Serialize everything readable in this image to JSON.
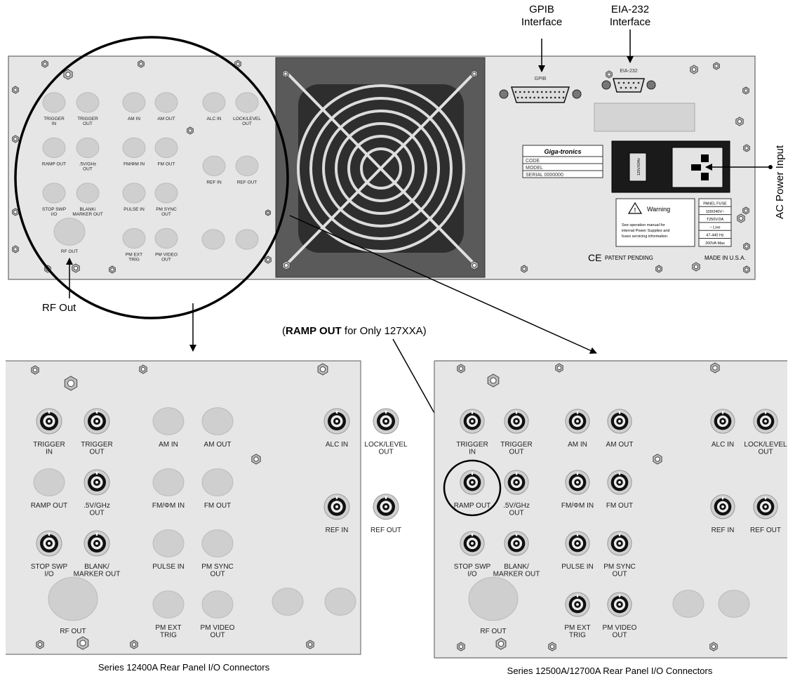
{
  "callouts": {
    "gpib_line1": "GPIB",
    "gpib_line2": "Interface",
    "eia_line1": "EIA-232",
    "eia_line2": "Interface",
    "ac_power": "AC Power Input",
    "rf_out": "RF Out",
    "ramp_note_open": "(",
    "ramp_note_bold": "RAMP OUT",
    "ramp_note_rest": " for Only 127XXA)"
  },
  "main_panel": {
    "labels": {
      "trigger_in": [
        "TRIGGER",
        "IN"
      ],
      "trigger_out": [
        "TRIGGER",
        "OUT"
      ],
      "am_in": "AM IN",
      "am_out": "AM OUT",
      "alc_in": "ALC IN",
      "lock_level_out": [
        "LOCK/LEVEL",
        "OUT"
      ],
      "ramp_out": "RAMP OUT",
      "ghz_out": [
        ".5V/GHz",
        "OUT"
      ],
      "fm_in": "FM/ΦM IN",
      "fm_out": "FM OUT",
      "ref_in": "REF IN",
      "ref_out": "REF OUT",
      "stop_swp": [
        "STOP SWP",
        "I/O"
      ],
      "blank_marker": [
        "BLANK/",
        "MARKER OUT"
      ],
      "pulse_in": "PULSE IN",
      "pm_sync_out": [
        "PM SYNC",
        "OUT"
      ],
      "rf_out": "RF OUT",
      "pm_ext_trig": [
        "PM EXT",
        "TRIG"
      ],
      "pm_video_out": [
        "PM VIDEO",
        "OUT"
      ]
    },
    "gpib_label": "GPIB",
    "eia_label": "EIA-232",
    "brand": "Giga-tronics",
    "id_rows": [
      "CODE",
      "MODEL",
      "SERIAL     0000000"
    ],
    "warning_title": "Warning",
    "warning_text": [
      "See operation manual for",
      "internal Power Supplies and",
      "fuses servicing information."
    ],
    "fuse_rows": [
      "PANEL FUSE",
      "100/240V~",
      "T250V/2A",
      "~ Line",
      "47-440 Hz",
      "200VA Max"
    ],
    "ce_mark": "CE",
    "patent": "PATENT PENDING",
    "made_in": "MADE IN U.S.A.",
    "switch_text": "120V/60Hz"
  },
  "panel_12400": {
    "caption": "Series 12400A Rear Panel I/O Connectors",
    "labels": {
      "trigger_in": [
        "TRIGGER",
        "IN"
      ],
      "trigger_out": [
        "TRIGGER",
        "OUT"
      ],
      "am_in": "AM IN",
      "am_out": "AM OUT",
      "alc_in": "ALC IN",
      "lock_level_out": [
        "LOCK/LEVEL",
        "OUT"
      ],
      "ramp_out": "RAMP OUT",
      "ghz_out": [
        ".5V/GHz",
        "OUT"
      ],
      "fm_in": "FM/ΦM IN",
      "fm_out": "FM OUT",
      "ref_in": "REF IN",
      "ref_out": "REF OUT",
      "stop_swp": [
        "STOP SWP",
        "I/O"
      ],
      "blank_marker": [
        "BLANK/",
        "MARKER OUT"
      ],
      "pulse_in": "PULSE IN",
      "pm_sync_out": [
        "PM SYNC",
        "OUT"
      ],
      "rf_out": "RF OUT",
      "pm_ext_trig": [
        "PM EXT",
        "TRIG"
      ],
      "pm_video_out": [
        "PM VIDEO",
        "OUT"
      ]
    }
  },
  "panel_12500": {
    "caption": "Series 12500A/12700A Rear Panel I/O Connectors",
    "labels": {
      "trigger_in": [
        "TRIGGER",
        "IN"
      ],
      "trigger_out": [
        "TRIGGER",
        "OUT"
      ],
      "am_in": "AM IN",
      "am_out": "AM OUT",
      "alc_in": "ALC IN",
      "lock_level_out": [
        "LOCK/LEVEL",
        "OUT"
      ],
      "ramp_out": "RAMP OUT",
      "ghz_out": [
        ".5V/GHz",
        "OUT"
      ],
      "fm_in": "FM/ΦM IN",
      "fm_out": "FM OUT",
      "ref_in": "REF IN",
      "ref_out": "REF OUT",
      "stop_swp": [
        "STOP SWP",
        "I/O"
      ],
      "blank_marker": [
        "BLANK/",
        "MARKER OUT"
      ],
      "pulse_in": "PULSE IN",
      "pm_sync_out": [
        "PM SYNC",
        "OUT"
      ],
      "rf_out": "RF OUT",
      "pm_ext_trig": [
        "PM EXT",
        "TRIG"
      ],
      "pm_video_out": [
        "PM VIDEO",
        "OUT"
      ]
    }
  },
  "colors": {
    "panel_fill": "#e6e6e6",
    "plug_fill": "#cfcfcf",
    "fan_bg": "#5a5a5a",
    "fan_inner": "#2e2e2e"
  }
}
